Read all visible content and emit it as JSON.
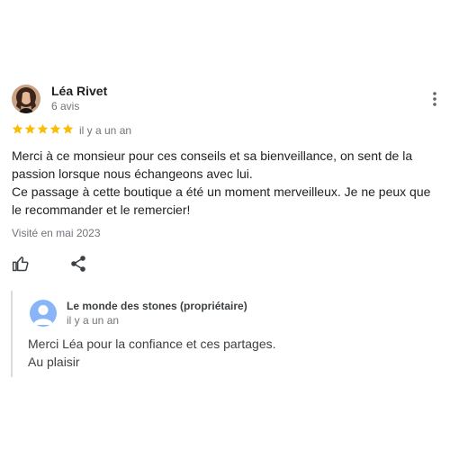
{
  "review": {
    "author": {
      "name": "Léa Rivet",
      "reviews_count": "6 avis",
      "avatar_icon": "profile-photo"
    },
    "rating": {
      "stars": 5,
      "max": 5,
      "color": "#fbbc04"
    },
    "date": "il y a un an",
    "text": {
      "paragraph_1": "Merci à ce monsieur pour ces conseils et sa bienveillance, on sent de la passion lorsque nous échangeons avec lui.",
      "paragraph_2": "Ce passage à cette boutique a été un moment merveilleux. Je ne peux que le recommander et le remercier!"
    },
    "visited": "Visité en mai 2023",
    "actions": {
      "like_icon": "thumbs-up-icon",
      "share_icon": "share-icon",
      "more_icon": "more-vert-icon"
    }
  },
  "owner_reply": {
    "name": "Le monde des stones (propriétaire)",
    "date": "il y a un an",
    "avatar_color": "#8ab4f8",
    "text": {
      "line_1": "Merci Léa pour la confiance et ces partages.",
      "line_2": "Au plaisir"
    }
  }
}
